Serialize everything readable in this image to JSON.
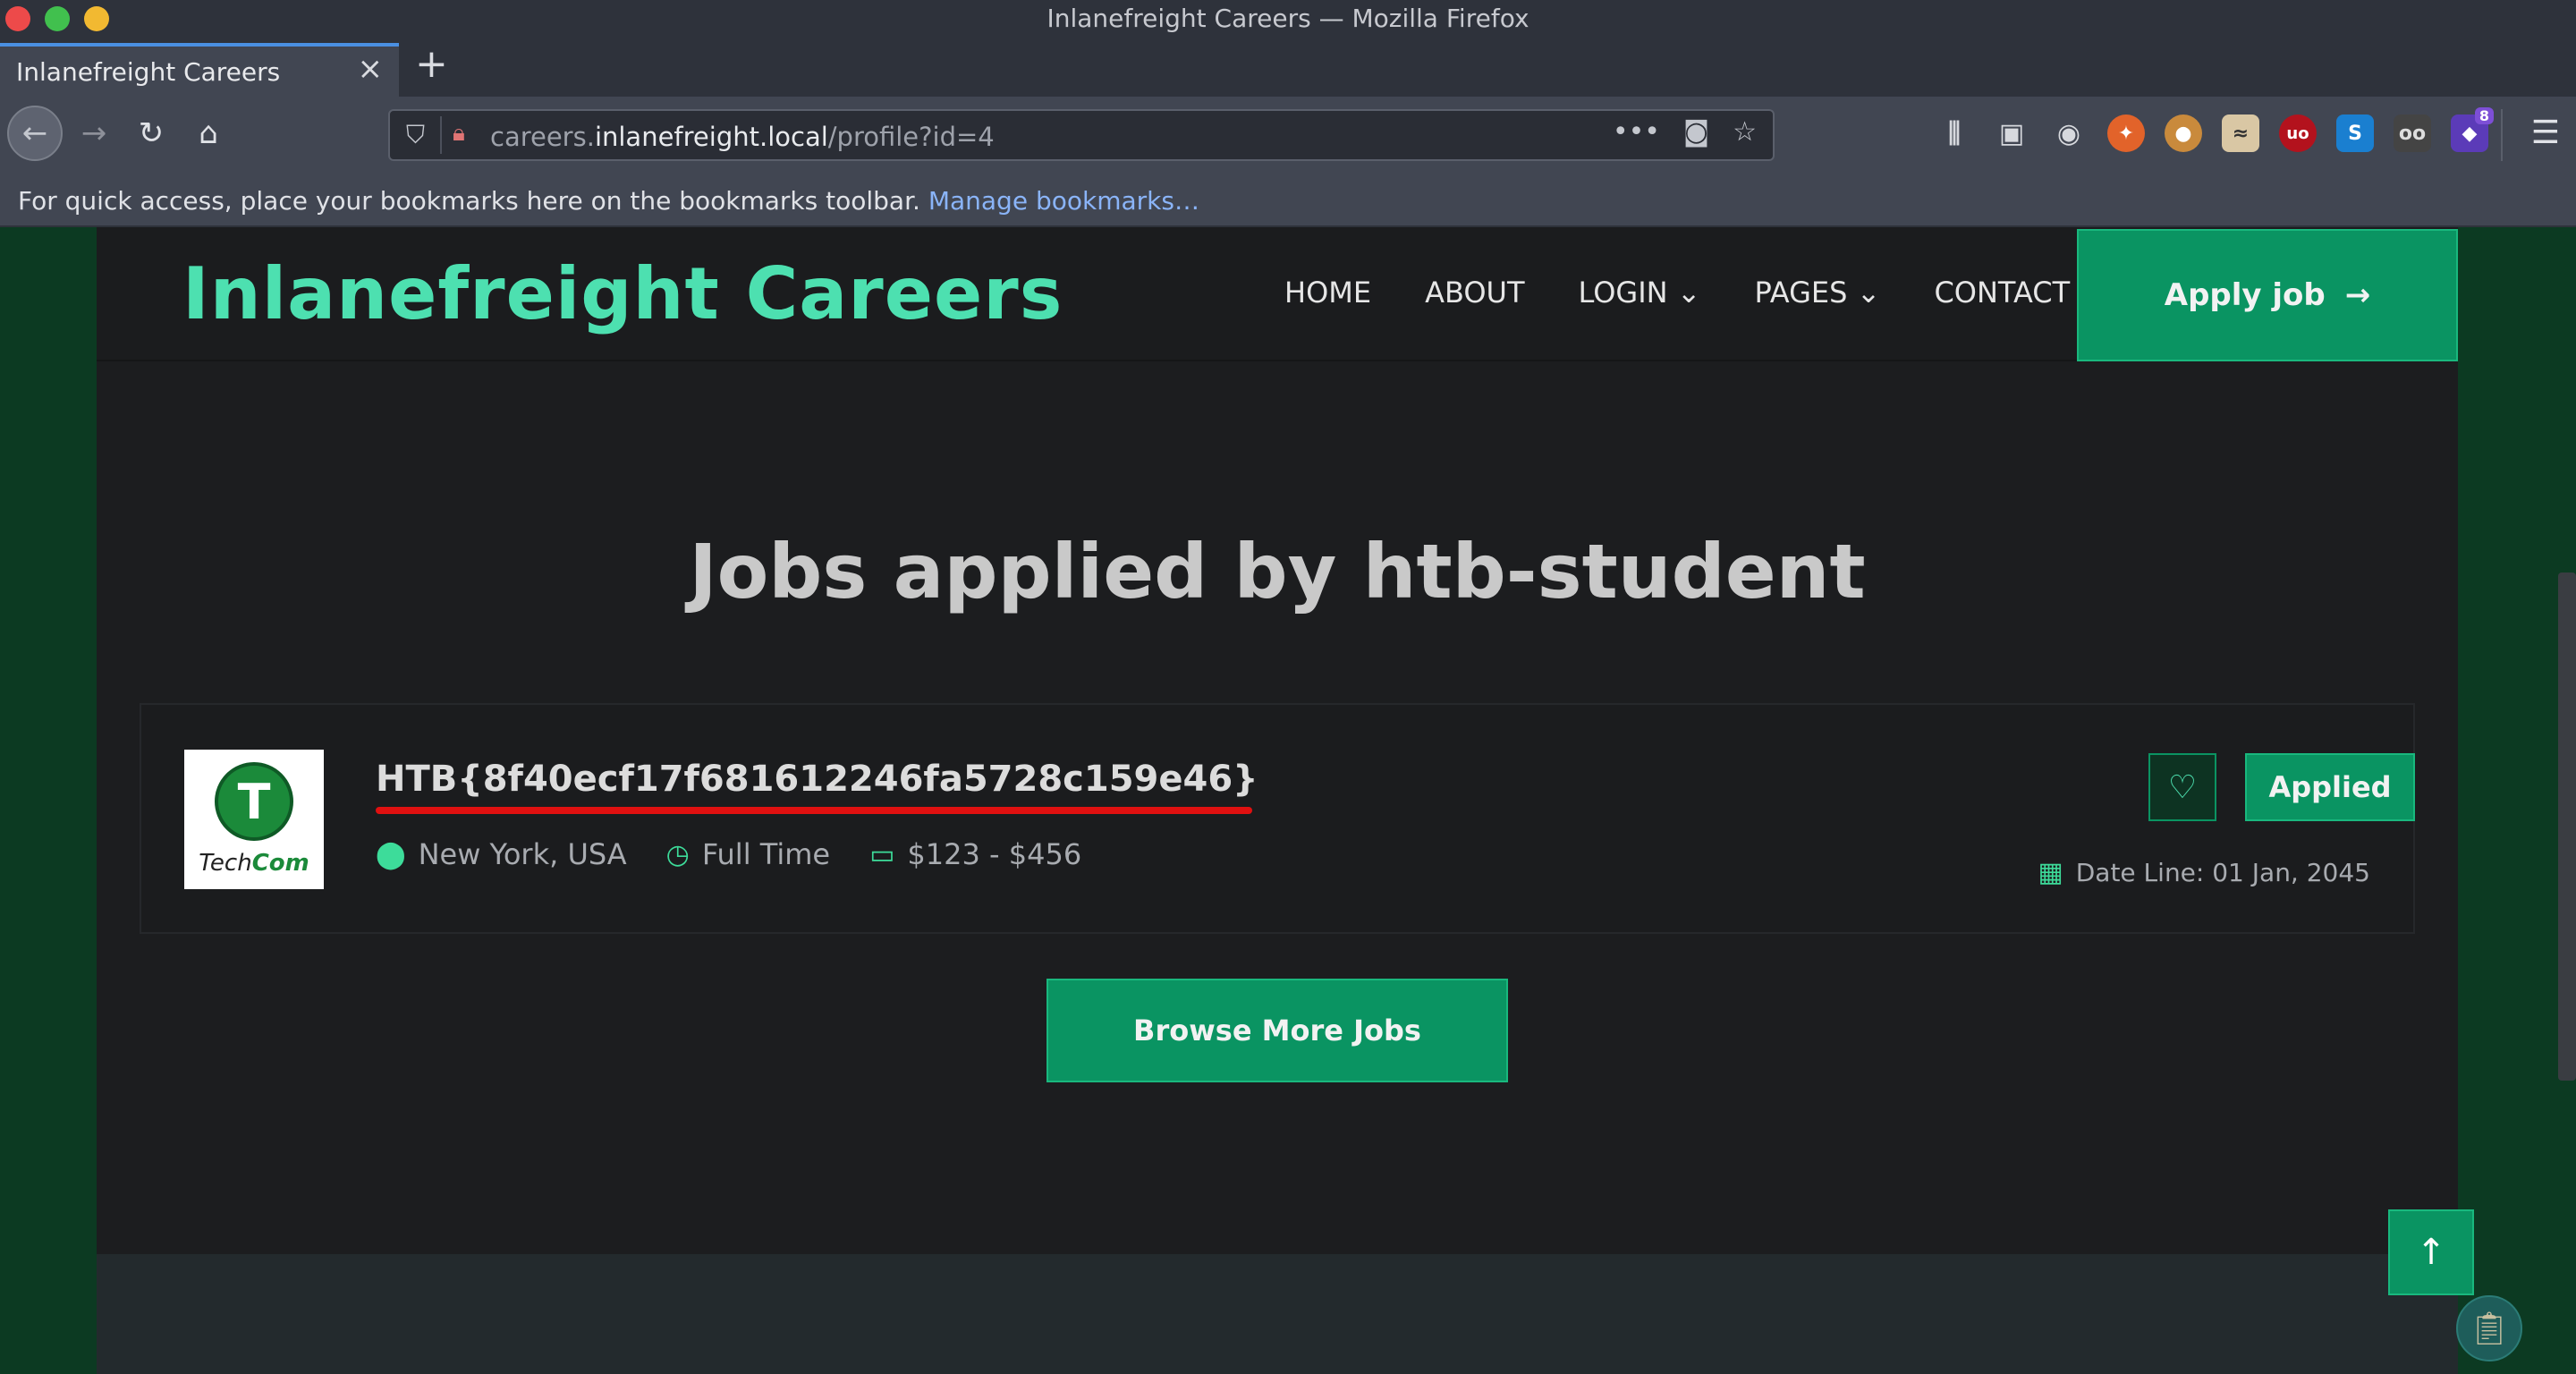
{
  "browser": {
    "window_title": "Inlanefreight Careers — Mozilla Firefox",
    "tab_title": "Inlanefreight Careers",
    "url_prefix": "careers.",
    "url_host": "inlanefreight.local",
    "url_path": "/profile?id=4",
    "bookmarks_text": "For quick access, place your bookmarks here on the bookmarks toolbar.",
    "bookmarks_link": "Manage bookmarks…",
    "extension_badge": "8"
  },
  "site": {
    "brand": "Inlanefreight Careers",
    "menu": [
      "HOME",
      "ABOUT",
      "LOGIN ⌄",
      "PAGES ⌄",
      "CONTACT"
    ],
    "apply_button": "Apply job"
  },
  "main": {
    "heading": "Jobs applied by htb-student",
    "job": {
      "company_logo_text_a": "Tech",
      "company_logo_text_b": "Com",
      "title": "HTB{8f40ecf17f681612246fa5728c159e46}",
      "location": "New York, USA",
      "type": "Full Time",
      "salary": "$123 - $456",
      "status_button": "Applied",
      "date_line": "Date Line: 01 Jan, 2045"
    },
    "browse_button": "Browse More Jobs"
  },
  "colors": {
    "accent": "#0a9462",
    "brand_text": "#4de0b0",
    "highlight_underline": "#e01010"
  }
}
